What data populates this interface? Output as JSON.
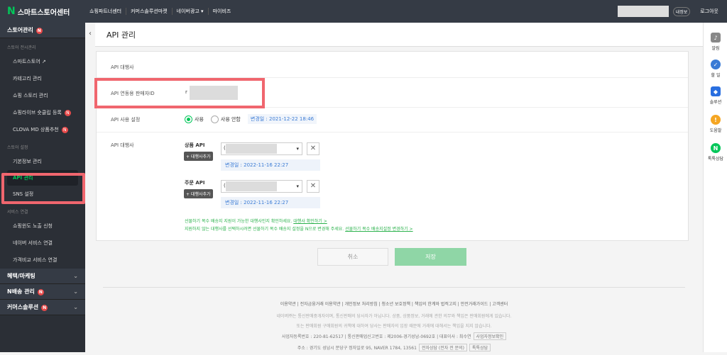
{
  "topbar": {
    "logo_letter": "N",
    "title": "스마트스토어센터",
    "nav": [
      "쇼핑파트너센터",
      "커머스솔루션마켓",
      "네이버광고 ▾",
      "마이비즈"
    ],
    "my_badge": "내정보",
    "logout": "로그아웃"
  },
  "sidebar": {
    "section_store": "스토어관리",
    "sub_store": "스토어 전시관리",
    "store_items": [
      "스마트스토어 ↗",
      "카테고리 관리",
      "쇼핑 스토리 관리",
      "쇼핑라이브 숏클립 등록",
      "CLOVA MD 상품추천"
    ],
    "sub_settings": "스토어 설정",
    "settings_items": [
      "기본정보 관리",
      "API 관리",
      "SNS 설정"
    ],
    "sub_service": "서비스 연결",
    "service_items": [
      "쇼핑윈도 노출 신청",
      "네이버 서비스 연결",
      "가격비교 서비스 연결"
    ],
    "section_benefit": "혜택/마케팅",
    "section_delivery": "N배송 관리",
    "section_commerce": "커머스솔루션",
    "new_badge": "N"
  },
  "header": {
    "title": "API 관리"
  },
  "card": {
    "label_agency": "API 대행사",
    "label_seller_id": "API 연동용 판매자ID",
    "seller_id_prefix": "r",
    "label_usage": "API 사용 설정",
    "use_label": "사용",
    "nouse_label": "사용 안함",
    "usage_changed": "변경일 : 2021-12-22 18:46",
    "label_agency2": "API 대행사",
    "product_api": "상품 API",
    "order_api": "주문 API",
    "add_agency": "+ 대행사추가",
    "select_prefix": "(",
    "product_changed": "변경일 : 2022-11-16 22:27",
    "order_changed": "변경일 : 2022-11-16 22:27",
    "notice1": "선물하기 복수 배송지 지원이 가능한 대행사인지 확인하세요.",
    "notice1_link": "대행사 확인하기 >",
    "notice2": "지원하지 않는 대행사를 선택하시려면 선물하기 복수 배송지 설정을 N으로 변경해 주세요.",
    "notice2_link": "선물하기 복수 배송지설정 변경하기 >"
  },
  "buttons": {
    "cancel": "취소",
    "save": "저장"
  },
  "footer": {
    "links": "이용약관 | 전자금융거래 이용약관 | 개인정보 처리방침 | 청소년 보호정책 | 책임의 한계와 법적고지 | 안전거래가이드 | 고객센터",
    "line1": "네이버㈜는 통신판매중개자이며, 통신판매의 당사자가 아닙니다. 상품, 상품정보, 거래에 관한 의무와 책임은 판매회원에게 있습니다.",
    "line2": "또는 판매회원 구매회원의 귀책에 대하여 당사는 판매자의 입장 때문에 거래에 대해서는 책임을 지지 않습니다.",
    "biz": "사업자등록번호 : 220-81-62517 | 통신판매업신고번호 : 제2006-경기성남-0692호 | 대표이사 : 최수연",
    "biz_chip": "사업자정보확인",
    "addr": "주소 : 경기도 성남시 분당구 정자일로 95, NAVER 1784, 13561",
    "addr_chip1": "전자상담 (전자 전 문의)",
    "addr_chip2": "톡톡상담"
  },
  "rightbar": [
    {
      "label": "알림",
      "icon": "bell-icon",
      "color": "#888888"
    },
    {
      "label": "할 일",
      "icon": "check-icon",
      "color": "#3a7bd5"
    },
    {
      "label": "솔루션",
      "icon": "solution-icon",
      "color": "#2a6fe0"
    },
    {
      "label": "도움말",
      "icon": "help-icon",
      "color": "#f5a623"
    },
    {
      "label": "톡톡상담",
      "icon": "talk-icon",
      "color": "#03c75a"
    }
  ]
}
